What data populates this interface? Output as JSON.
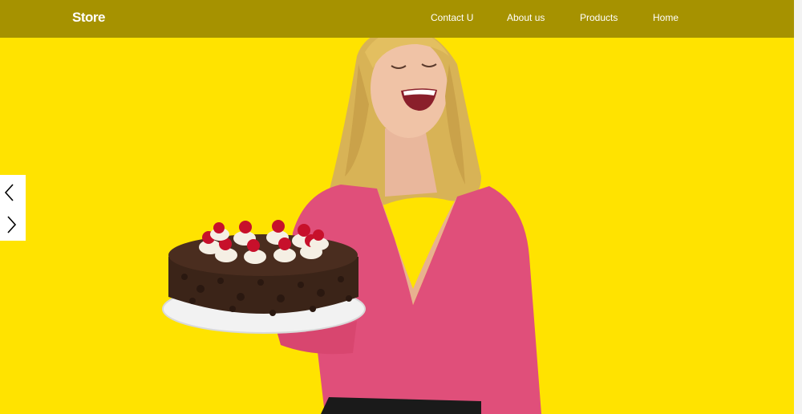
{
  "navbar": {
    "brand": "Store",
    "links": [
      "Contact U",
      "About us",
      "Products",
      "Home"
    ]
  },
  "hero": {
    "image": "woman-laughing-with-birthday-cake-photo",
    "background_color": "#ffe300"
  },
  "carousel": {
    "prev_icon": "chevron-left-icon",
    "next_icon": "chevron-right-icon"
  },
  "colors": {
    "navbar": "#a69200",
    "text": "#ffffff",
    "shirt": "#e04f7a"
  }
}
